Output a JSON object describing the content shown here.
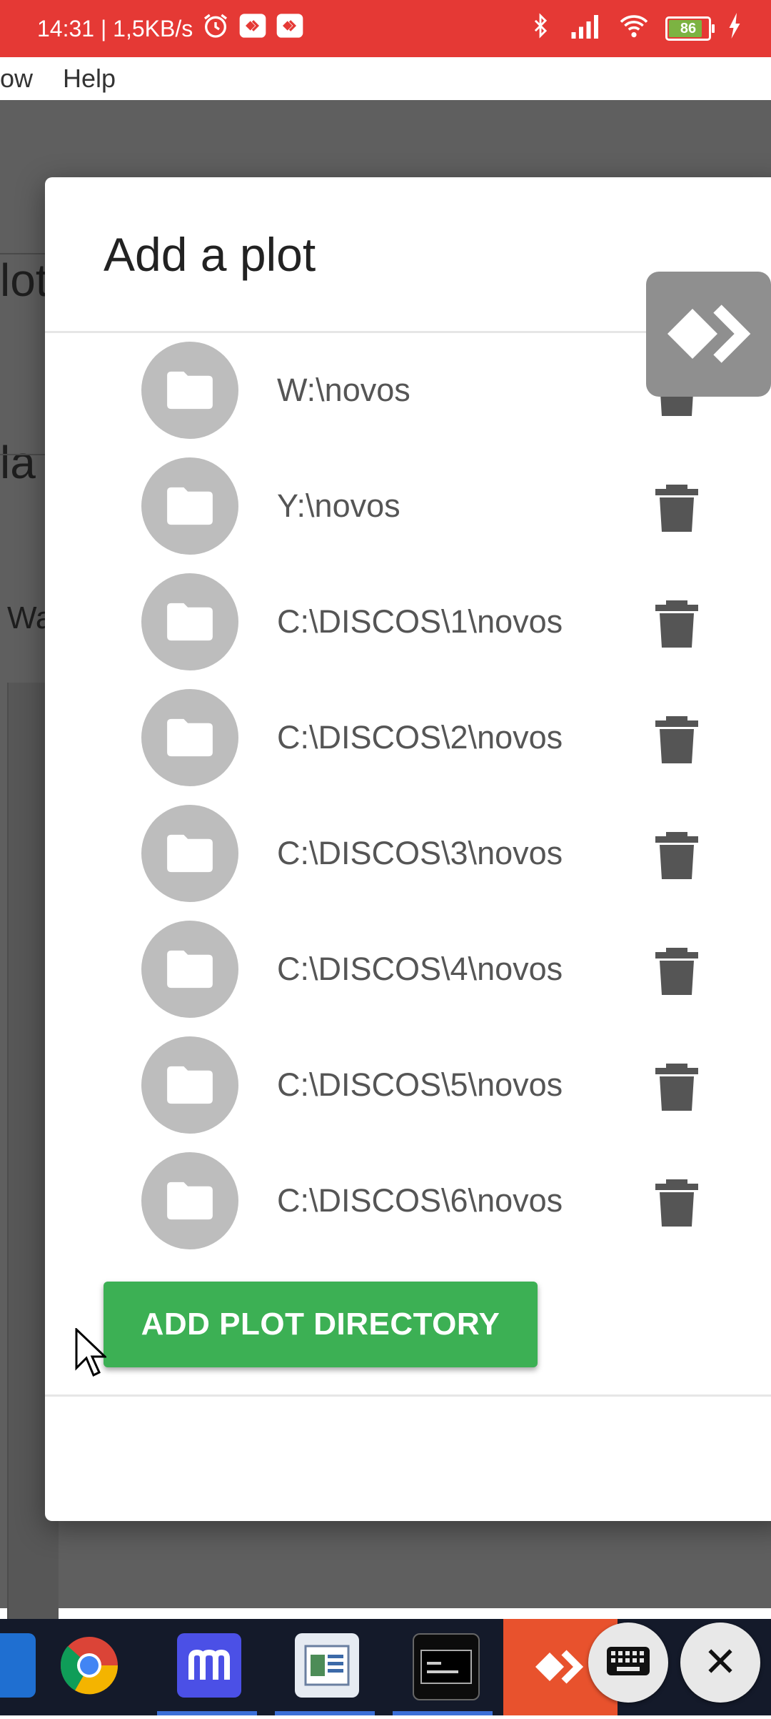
{
  "status_bar": {
    "time_speed": "14:31 | 1,5KB/s",
    "battery": "86"
  },
  "menubar": {
    "item_partial": "ow",
    "help": "Help"
  },
  "background": {
    "title_partial": "lot",
    "heading_partial": "la",
    "label_partial": "Wa"
  },
  "dialog": {
    "title": "Add a plot",
    "directories": [
      {
        "path": "W:\\novos"
      },
      {
        "path": "Y:\\novos"
      },
      {
        "path": "C:\\DISCOS\\1\\novos"
      },
      {
        "path": "C:\\DISCOS\\2\\novos"
      },
      {
        "path": "C:\\DISCOS\\3\\novos"
      },
      {
        "path": "C:\\DISCOS\\4\\novos"
      },
      {
        "path": "C:\\DISCOS\\5\\novos"
      },
      {
        "path": "C:\\DISCOS\\6\\novos"
      }
    ],
    "add_button": "ADD PLOT DIRECTORY"
  },
  "colors": {
    "status_bar": "#e53935",
    "primary_button": "#3cb054",
    "avatar": "#bdbdbd",
    "trash": "#555555"
  },
  "taskbar": {
    "apps": [
      "windows-icon",
      "chrome-icon",
      "m-app-icon",
      "document-icon",
      "terminal-icon",
      "anydesk-icon"
    ],
    "floating": [
      "keyboard-icon",
      "close-icon"
    ]
  }
}
